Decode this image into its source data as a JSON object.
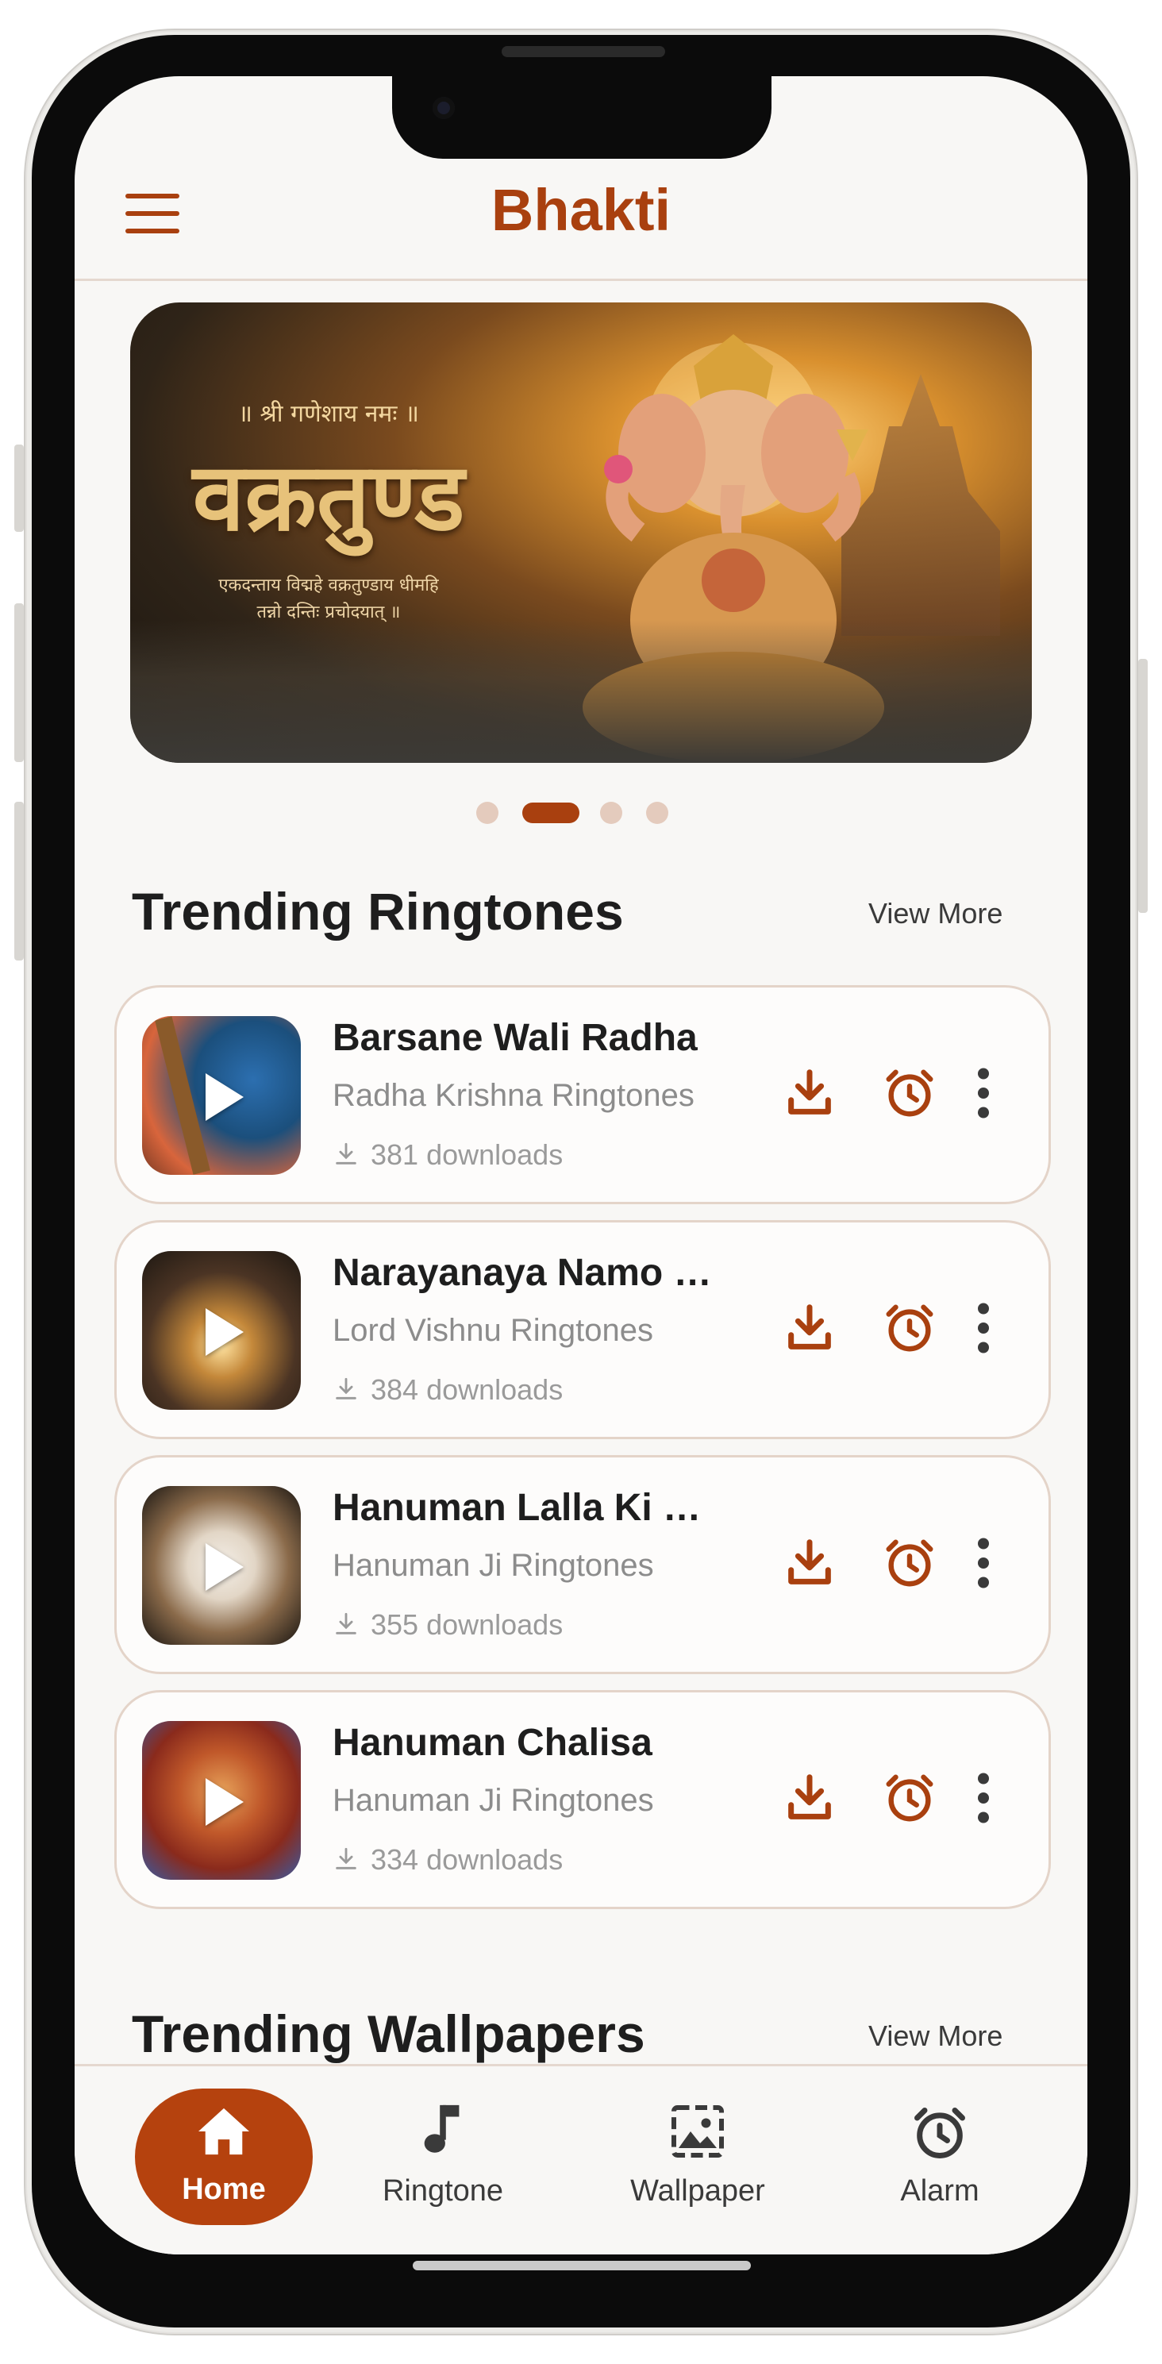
{
  "app": {
    "title": "Bhakti"
  },
  "banner": {
    "line_top": "॥ श्री गणेशाय नमः ॥",
    "title": "वक्रतुण्ड",
    "line_sub_1": "एकदन्ताय विद्महे वक्रतुण्डाय धीमहि",
    "line_sub_2": "तन्नो दन्तिः प्रचोदयात् ॥",
    "active_slide": 2,
    "slide_count": 4
  },
  "sections": {
    "ringtones": {
      "title": "Trending Ringtones",
      "view_more": "View More"
    },
    "wallpapers": {
      "title": "Trending Wallpapers",
      "view_more": "View More"
    }
  },
  "ringtones": [
    {
      "title": "Barsane Wali Radha",
      "category": "Radha Krishna Ringtones",
      "downloads": "381 downloads"
    },
    {
      "title": "Narayanaya Namo …",
      "category": "Lord Vishnu Ringtones",
      "downloads": "384 downloads"
    },
    {
      "title": "Hanuman Lalla Ki …",
      "category": "Hanuman Ji Ringtones",
      "downloads": "355 downloads"
    },
    {
      "title": "Hanuman Chalisa",
      "category": "Hanuman Ji Ringtones",
      "downloads": "334 downloads"
    }
  ],
  "nav": [
    {
      "label": "Home",
      "icon": "home-icon",
      "active": true
    },
    {
      "label": "Ringtone",
      "icon": "music-note-icon",
      "active": false
    },
    {
      "label": "Wallpaper",
      "icon": "image-icon",
      "active": false
    },
    {
      "label": "Alarm",
      "icon": "alarm-clock-icon",
      "active": false
    }
  ],
  "colors": {
    "accent": "#a9400f",
    "nav_active_bg": "#b5420e",
    "background": "#f8f7f5",
    "card_border": "#e4d4c9"
  }
}
